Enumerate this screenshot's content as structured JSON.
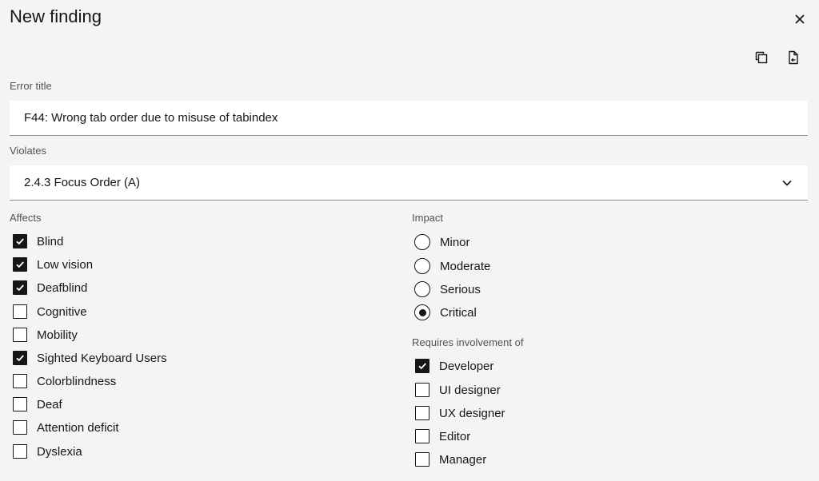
{
  "title": "New finding",
  "toolbar": {
    "close_icon": "close-icon",
    "copy_icon": "copy-icon",
    "paste_icon": "paste-icon"
  },
  "error_title": {
    "label": "Error title",
    "value": "F44: Wrong tab order due to misuse of tabindex"
  },
  "violates": {
    "label": "Violates",
    "value": "2.4.3 Focus Order (A)"
  },
  "affects": {
    "label": "Affects",
    "items": [
      {
        "label": "Blind",
        "checked": true
      },
      {
        "label": "Low vision",
        "checked": true
      },
      {
        "label": "Deafblind",
        "checked": true
      },
      {
        "label": "Cognitive",
        "checked": false
      },
      {
        "label": "Mobility",
        "checked": false
      },
      {
        "label": "Sighted Keyboard Users",
        "checked": true
      },
      {
        "label": "Colorblindness",
        "checked": false
      },
      {
        "label": "Deaf",
        "checked": false
      },
      {
        "label": "Attention deficit",
        "checked": false
      },
      {
        "label": "Dyslexia",
        "checked": false
      }
    ]
  },
  "impact": {
    "label": "Impact",
    "items": [
      {
        "label": "Minor",
        "selected": false
      },
      {
        "label": "Moderate",
        "selected": false
      },
      {
        "label": "Serious",
        "selected": false
      },
      {
        "label": "Critical",
        "selected": true
      }
    ]
  },
  "involvement": {
    "label": "Requires involvement of",
    "items": [
      {
        "label": "Developer",
        "checked": true
      },
      {
        "label": "UI designer",
        "checked": false
      },
      {
        "label": "UX designer",
        "checked": false
      },
      {
        "label": "Editor",
        "checked": false
      },
      {
        "label": "Manager",
        "checked": false
      }
    ]
  },
  "colors": {
    "background": "#f4f4f4",
    "field": "#ffffff",
    "text": "#161616",
    "label": "#525252"
  }
}
